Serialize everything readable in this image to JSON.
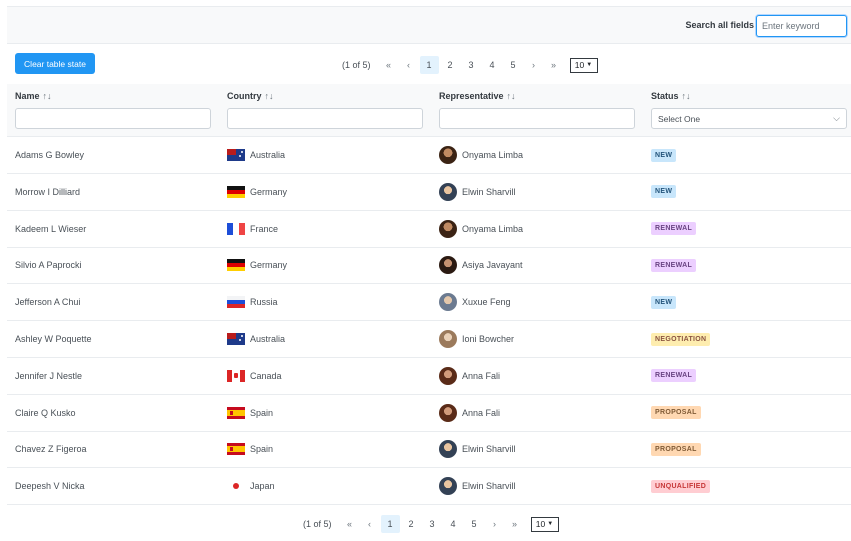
{
  "search": {
    "label": "Search all fields",
    "placeholder": "Enter keyword"
  },
  "toolbar": {
    "clear_label": "Clear table state"
  },
  "paginator": {
    "report": "(1 of 5)",
    "first": "«",
    "prev": "‹",
    "next": "›",
    "last": "»",
    "pages": [
      "1",
      "2",
      "3",
      "4",
      "5"
    ],
    "active_page": "1",
    "rows_per_page": "10"
  },
  "columns": {
    "name": "Name",
    "country": "Country",
    "representative": "Representative",
    "status": "Status",
    "sort_icon": "↑↓"
  },
  "status_filter": {
    "placeholder": "Select One"
  },
  "rows": [
    {
      "name": "Adams G Bowley",
      "country": "Australia",
      "rep": "Onyama Limba",
      "status": "NEW"
    },
    {
      "name": "Morrow I Dilliard",
      "country": "Germany",
      "rep": "Elwin Sharvill",
      "status": "NEW"
    },
    {
      "name": "Kadeem L Wieser",
      "country": "France",
      "rep": "Onyama Limba",
      "status": "RENEWAL"
    },
    {
      "name": "Silvio A Paprocki",
      "country": "Germany",
      "rep": "Asiya Javayant",
      "status": "RENEWAL"
    },
    {
      "name": "Jefferson A Chui",
      "country": "Russia",
      "rep": "Xuxue Feng",
      "status": "NEW"
    },
    {
      "name": "Ashley W Poquette",
      "country": "Australia",
      "rep": "Ioni Bowcher",
      "status": "NEGOTIATION"
    },
    {
      "name": "Jennifer J Nestle",
      "country": "Canada",
      "rep": "Anna Fali",
      "status": "RENEWAL"
    },
    {
      "name": "Claire Q Kusko",
      "country": "Spain",
      "rep": "Anna Fali",
      "status": "PROPOSAL"
    },
    {
      "name": "Chavez Z Figeroa",
      "country": "Spain",
      "rep": "Elwin Sharvill",
      "status": "PROPOSAL"
    },
    {
      "name": "Deepesh V Nicka",
      "country": "Japan",
      "rep": "Elwin Sharvill",
      "status": "UNQUALIFIED"
    }
  ],
  "colors": {
    "primary": "#2196f3",
    "new_bg": "#c8e6fb",
    "renewal_bg": "#eccfff",
    "negotiation_bg": "#feedaf",
    "proposal_bg": "#ffd8b2",
    "unqualified_bg": "#ffcdd2"
  }
}
